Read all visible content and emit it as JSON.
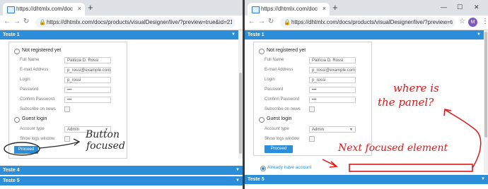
{
  "browser": {
    "tab_title": "https://dhtmlx.com/docs/produc",
    "tab_close": "×",
    "new_tab": "+",
    "url": "https://dhtmlx.com/docs/products/visualDesigner/live/?preview=true&id=216...",
    "avatar_letter": "M",
    "window_controls": [
      "—",
      "☐",
      "✕"
    ]
  },
  "left": {
    "accordion_top": "Teste 1",
    "accordion_4": "Teste 4",
    "accordion_5": "Teste 5",
    "radio_not_registered": "Not registered yet",
    "fields": [
      {
        "label": "Full Name",
        "value": "Patricia D. Rossi"
      },
      {
        "label": "E-mail Address",
        "value": "p_rossi@example.com"
      },
      {
        "label": "Login",
        "value": "p_rossi"
      },
      {
        "label": "Password",
        "value": "•••"
      },
      {
        "label": "Confirm Password",
        "value": "•••"
      }
    ],
    "subscribe_label": "Subscribe on news",
    "radio_guest": "Guest login",
    "account_type_label": "Account type",
    "account_type_value": "Admin",
    "show_logs_label": "Show logs window",
    "proceed_button": "Proceed",
    "annotation_line1": "Button",
    "annotation_line2": "focused"
  },
  "right": {
    "accordion_top": "Teste 1",
    "accordion_5": "Teste 5",
    "radio_not_registered": "Not registered yet",
    "fields": [
      {
        "label": "Full Name",
        "value": "Patricia D. Rossi"
      },
      {
        "label": "E-mail Address",
        "value": "p_rossi@example.com"
      },
      {
        "label": "Login",
        "value": "p_rossi"
      },
      {
        "label": "Password",
        "value": "•••"
      },
      {
        "label": "Confirm Password",
        "value": "•••"
      }
    ],
    "subscribe_label": "Subscribe on news",
    "radio_guest": "Guest login",
    "account_type_label": "Account type",
    "account_type_value": "Admin",
    "show_logs_label": "Show logs window",
    "proceed_button": "Proceed",
    "already_have_account": "Already have account",
    "annotation_where_line1": "where is",
    "annotation_where_line2": "the panel?",
    "annotation_next": "Next focused element"
  },
  "colors": {
    "accent": "#2c8ed8",
    "annotation_red": "#e01515",
    "annotation_dark": "#2a2a2a"
  }
}
